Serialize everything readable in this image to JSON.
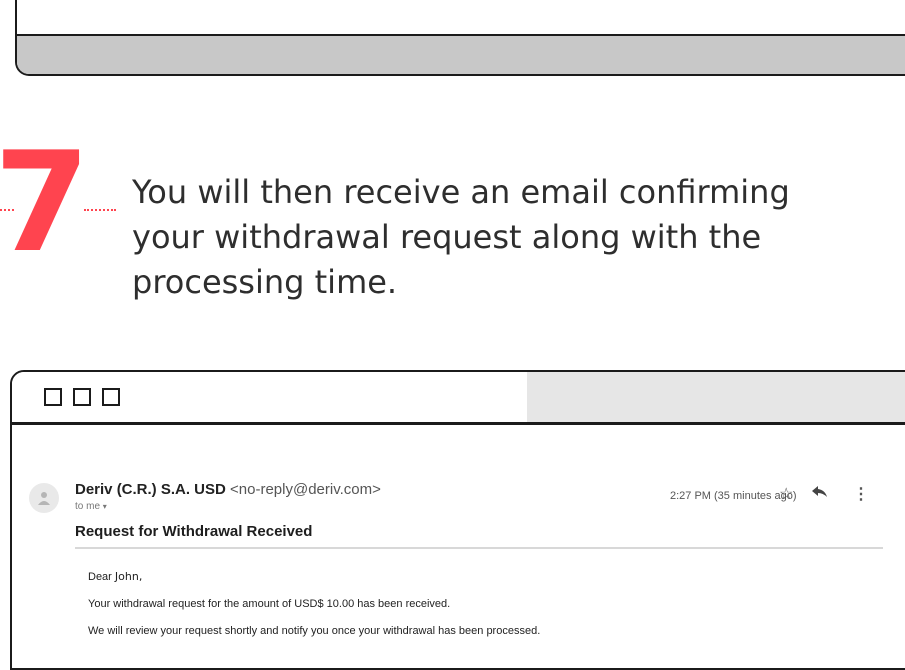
{
  "step": {
    "number": "7",
    "text": "You will then receive an email confirming your withdrawal request along with the processing time."
  },
  "colors": {
    "accent": "#ff444f",
    "frame_border": "#1b1b1b",
    "titlebar_gray": "#e6e6e6",
    "top_bar_gray": "#c8c8c8"
  },
  "email": {
    "sender_name": "Deriv (C.R.) S.A. USD",
    "sender_address": "<no-reply@deriv.com>",
    "recipient": "to me",
    "timestamp": "2:27 PM (35 minutes ago)",
    "subject": "Request for Withdrawal Received",
    "greeting_prefix": "Dear",
    "greeting_name": "John,",
    "paragraphs": [
      "Your withdrawal request for the amount of USD$ 10.00 has been received.",
      "We will review your request shortly and notify you once your withdrawal has been processed."
    ],
    "icons": {
      "avatar": "person-icon",
      "star": "star-icon",
      "reply": "reply-icon",
      "more": "more-vert-icon"
    }
  }
}
